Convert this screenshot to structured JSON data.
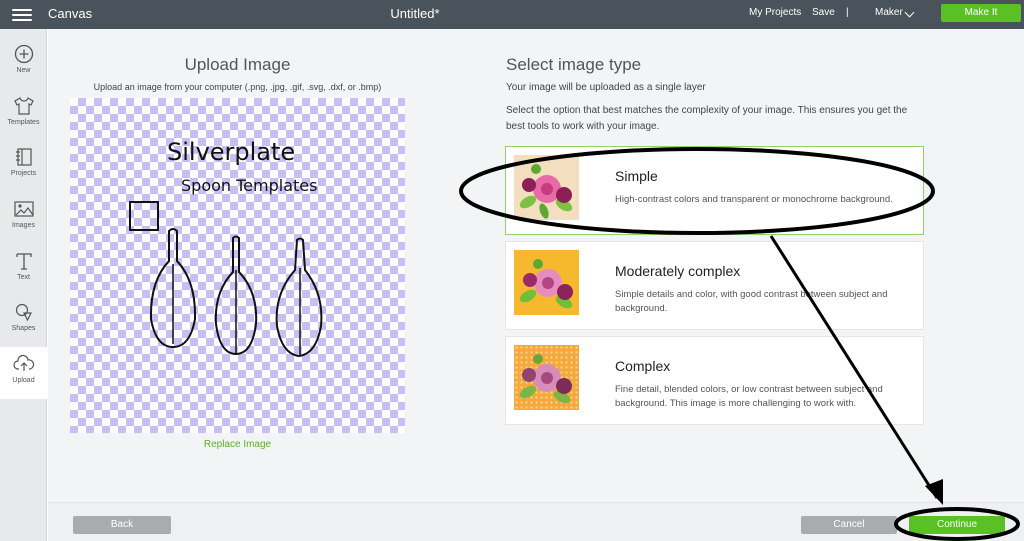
{
  "topbar": {
    "app_title": "Canvas",
    "doc_title": "Untitled*",
    "my_projects": "My Projects",
    "save": "Save",
    "separator": "|",
    "machine": "Maker",
    "make_it": "Make It"
  },
  "sidebar": {
    "items": [
      {
        "label": "New",
        "icon": "plus-circle-icon"
      },
      {
        "label": "Templates",
        "icon": "tshirt-icon"
      },
      {
        "label": "Projects",
        "icon": "notebook-icon"
      },
      {
        "label": "Images",
        "icon": "image-icon"
      },
      {
        "label": "Text",
        "icon": "text-t-icon"
      },
      {
        "label": "Shapes",
        "icon": "shapes-icon"
      },
      {
        "label": "Upload",
        "icon": "upload-cloud-icon"
      }
    ],
    "active": "Upload"
  },
  "upload": {
    "title": "Upload Image",
    "subtitle": "Upload an image from your computer (.png, .jpg, .gif, .svg, .dxf, or .bmp)",
    "preview_text_line1": "Silverplate",
    "preview_text_line2": "Spoon Templates",
    "replace_link": "Replace Image"
  },
  "select_type": {
    "title": "Select image type",
    "subtitle": "Your image will be uploaded as a single layer",
    "description": "Select the option that best matches the complexity of your image. This ensures you get the best tools to work with your image.",
    "options": [
      {
        "name": "Simple",
        "description": "High-contrast colors and transparent or monochrome background.",
        "selected": true
      },
      {
        "name": "Moderately complex",
        "description": "Simple details and color, with good contrast between subject and background.",
        "selected": false
      },
      {
        "name": "Complex",
        "description": "Fine detail, blended colors, or low contrast between subject and background. This image is more challenging to work with.",
        "selected": false
      }
    ]
  },
  "footer": {
    "back": "Back",
    "cancel": "Cancel",
    "continue": "Continue"
  },
  "colors": {
    "topbar": "#4a535b",
    "accent_green": "#59c126",
    "link_green": "#59b026",
    "checker_purple": "#c9bff7",
    "annotation": "#000000"
  }
}
